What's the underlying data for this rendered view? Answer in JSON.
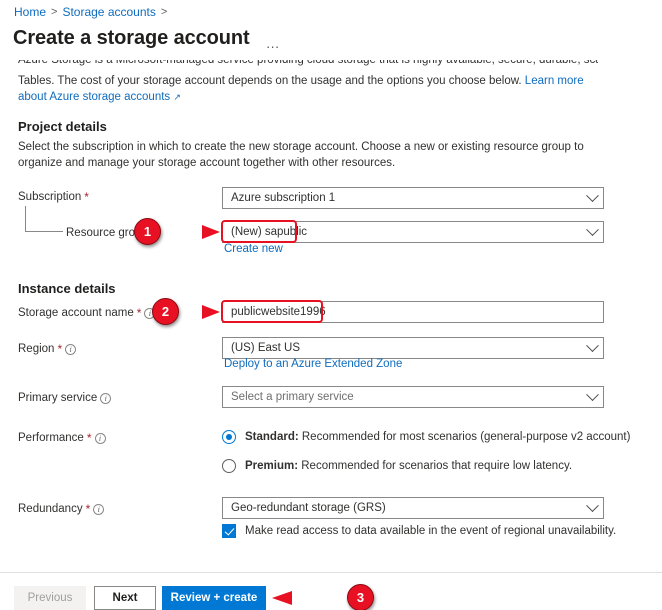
{
  "breadcrumb": {
    "items": [
      "Home",
      "Storage accounts"
    ],
    "separator": ">"
  },
  "header": {
    "title": "Create a storage account",
    "more_label": "…"
  },
  "description": {
    "clipped_line": "Azure Storage is a Microsoft-managed service providing cloud storage that is highly available, secure, durable, scalable, and redundant. Azure Storage includes Azure Blobs (objects), Azure Data Lake Storage Gen2, Azure Files, Azure Queues, and Azure",
    "text": "Tables. The cost of your storage account depends on the usage and the options you choose below.",
    "link": "Learn more about Azure storage accounts",
    "external_icon": "external-link-icon"
  },
  "project_details": {
    "heading": "Project details",
    "subtext": "Select the subscription in which to create the new storage account. Choose a new or existing resource group to organize and manage your storage account together with other resources.",
    "subscription": {
      "label": "Subscription",
      "required": "*",
      "value": "Azure subscription 1"
    },
    "resource_group": {
      "label": "Resource group",
      "value": "(New) sapublic",
      "create_new_link": "Create new"
    }
  },
  "instance_details": {
    "heading": "Instance details",
    "storage_account_name": {
      "label": "Storage account name",
      "required": "*",
      "value": "publicwebsite1996"
    },
    "region": {
      "label": "Region",
      "required": "*",
      "value": "(US) East US",
      "sublink": "Deploy to an Azure Extended Zone"
    },
    "primary_service": {
      "label": "Primary service",
      "placeholder": "Select a primary service",
      "value": "Select a primary service"
    },
    "performance": {
      "label": "Performance",
      "required": "*",
      "options": [
        {
          "name": "Standard:",
          "text": " Recommended for most scenarios (general-purpose v2 account)",
          "selected": true
        },
        {
          "name": "Premium:",
          "text": " Recommended for scenarios that require low latency.",
          "selected": false
        }
      ]
    },
    "redundancy": {
      "label": "Redundancy",
      "required": "*",
      "value": "Geo-redundant storage (GRS)",
      "checkbox_label": "Make read access to data available in the event of regional unavailability.",
      "checkbox_checked": true
    }
  },
  "footer": {
    "previous_label": "Previous",
    "next_label": "Next",
    "review_label": "Review + create"
  },
  "annotations": {
    "marker_1": "1",
    "marker_2": "2",
    "marker_3": "3"
  },
  "colors": {
    "accent": "#0078d4",
    "link": "#0f6cbd",
    "annotation": "#e81123",
    "required": "#a4262c"
  }
}
